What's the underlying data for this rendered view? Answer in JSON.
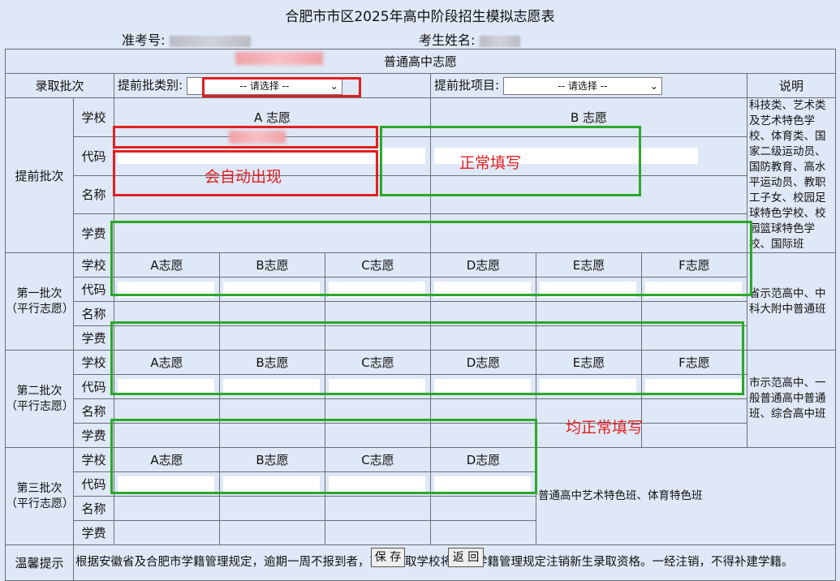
{
  "page": {
    "title": "合肥市市区2025年高中阶段招生模拟志愿表",
    "exam_no_label": "准考号:",
    "student_name_label": "考生姓名:"
  },
  "form": {
    "header": "普通高中志愿",
    "batch_label": "录取批次",
    "early_type_label": "提前批类别:",
    "early_item_label": "提前批项目:",
    "select_placeholder": "-- 请选择 --",
    "explain_header": "说明",
    "row_labels": {
      "school": "学校",
      "code": "代码",
      "name": "名称",
      "fee": "学费"
    },
    "early": {
      "label": "提前批次",
      "choice_a": "A 志愿",
      "choice_b": "B 志愿",
      "note": "科技类、艺术类及艺术特色学校、体育类、国家二级运动员、国防教育、高水平运动员、教职工子女、校园足球特色学校、校园篮球特色学校、国际班"
    },
    "first": {
      "label": "第一批次（平行志愿）",
      "choices": [
        "A志愿",
        "B志愿",
        "C志愿",
        "D志愿",
        "E志愿",
        "F志愿"
      ],
      "note": "省示范高中、中科大附中普通班"
    },
    "second": {
      "label": "第二批次（平行志愿）",
      "choices": [
        "A志愿",
        "B志愿",
        "C志愿",
        "D志愿",
        "E志愿",
        "F志愿"
      ],
      "note": "市示范高中、一般普通高中普通班、综合高中班"
    },
    "third": {
      "label": "第三批次（平行志愿）",
      "choices": [
        "A志愿",
        "B志愿",
        "C志愿",
        "D志愿"
      ],
      "note": "普通高中艺术特色班、体育特色班"
    },
    "tip_label": "温馨提示",
    "tip_text": "根据安徽省及合肥市学籍管理规定，逾期一周不报到者，高中录取学校将依据学籍管理规定注销新生录取资格。一经注销，不得补建学籍。"
  },
  "annotations": {
    "auto": "会自动出现",
    "normal": "正常填写",
    "all_normal": "均正常填写"
  },
  "buttons": {
    "save": "保 存",
    "back": "返 回"
  },
  "colors": {
    "highlight_red": "#e02020",
    "highlight_green": "#2aa82a",
    "background": "#dfe8f6"
  }
}
